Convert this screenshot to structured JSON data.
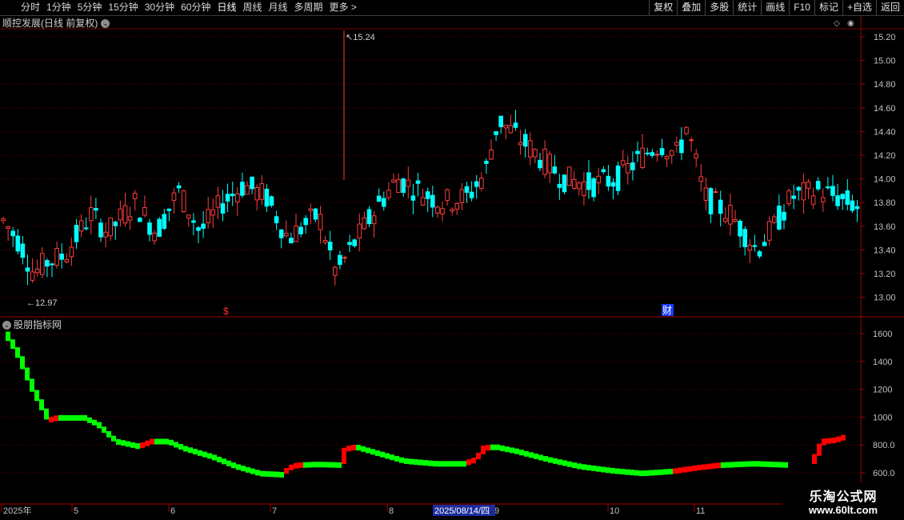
{
  "toolbar": {
    "tabs": [
      "分时",
      "1分钟",
      "5分钟",
      "15分钟",
      "30分钟",
      "60分钟",
      "日线",
      "周线",
      "月线",
      "多周期",
      "更多 >"
    ],
    "active_tab": 6,
    "right_buttons": [
      "复权",
      "叠加",
      "多股",
      "统计",
      "画线",
      "F10",
      "标记",
      "+自选",
      "返回"
    ]
  },
  "main_panel": {
    "title": "顺控发展(日线 前复权)",
    "high_marker": "15.24",
    "low_marker": "12.97",
    "events": [
      "$",
      "财"
    ],
    "y_ticks": [
      "15.20",
      "15.00",
      "14.80",
      "14.60",
      "14.40",
      "14.20",
      "14.00",
      "13.80",
      "13.60",
      "13.40",
      "13.20",
      "13.00"
    ]
  },
  "sub_panel": {
    "title": "股朋指标网",
    "y_ticks": [
      "1600",
      "1400",
      "1200",
      "1000",
      "800.0",
      "600.0"
    ]
  },
  "date_axis": {
    "labels": [
      "2025年",
      "5",
      "6",
      "7",
      "8",
      "9",
      "10",
      "11"
    ],
    "cursor_date": "2025/08/14/四"
  },
  "watermark": {
    "line1": "乐淘公式网",
    "line2": "www.60lt.com"
  },
  "colors": {
    "up": "#ff3c3c",
    "down": "#00ffff",
    "indicator_up": "#ff0000",
    "indicator_down": "#00ff00",
    "axis_red": "#b00000"
  }
}
